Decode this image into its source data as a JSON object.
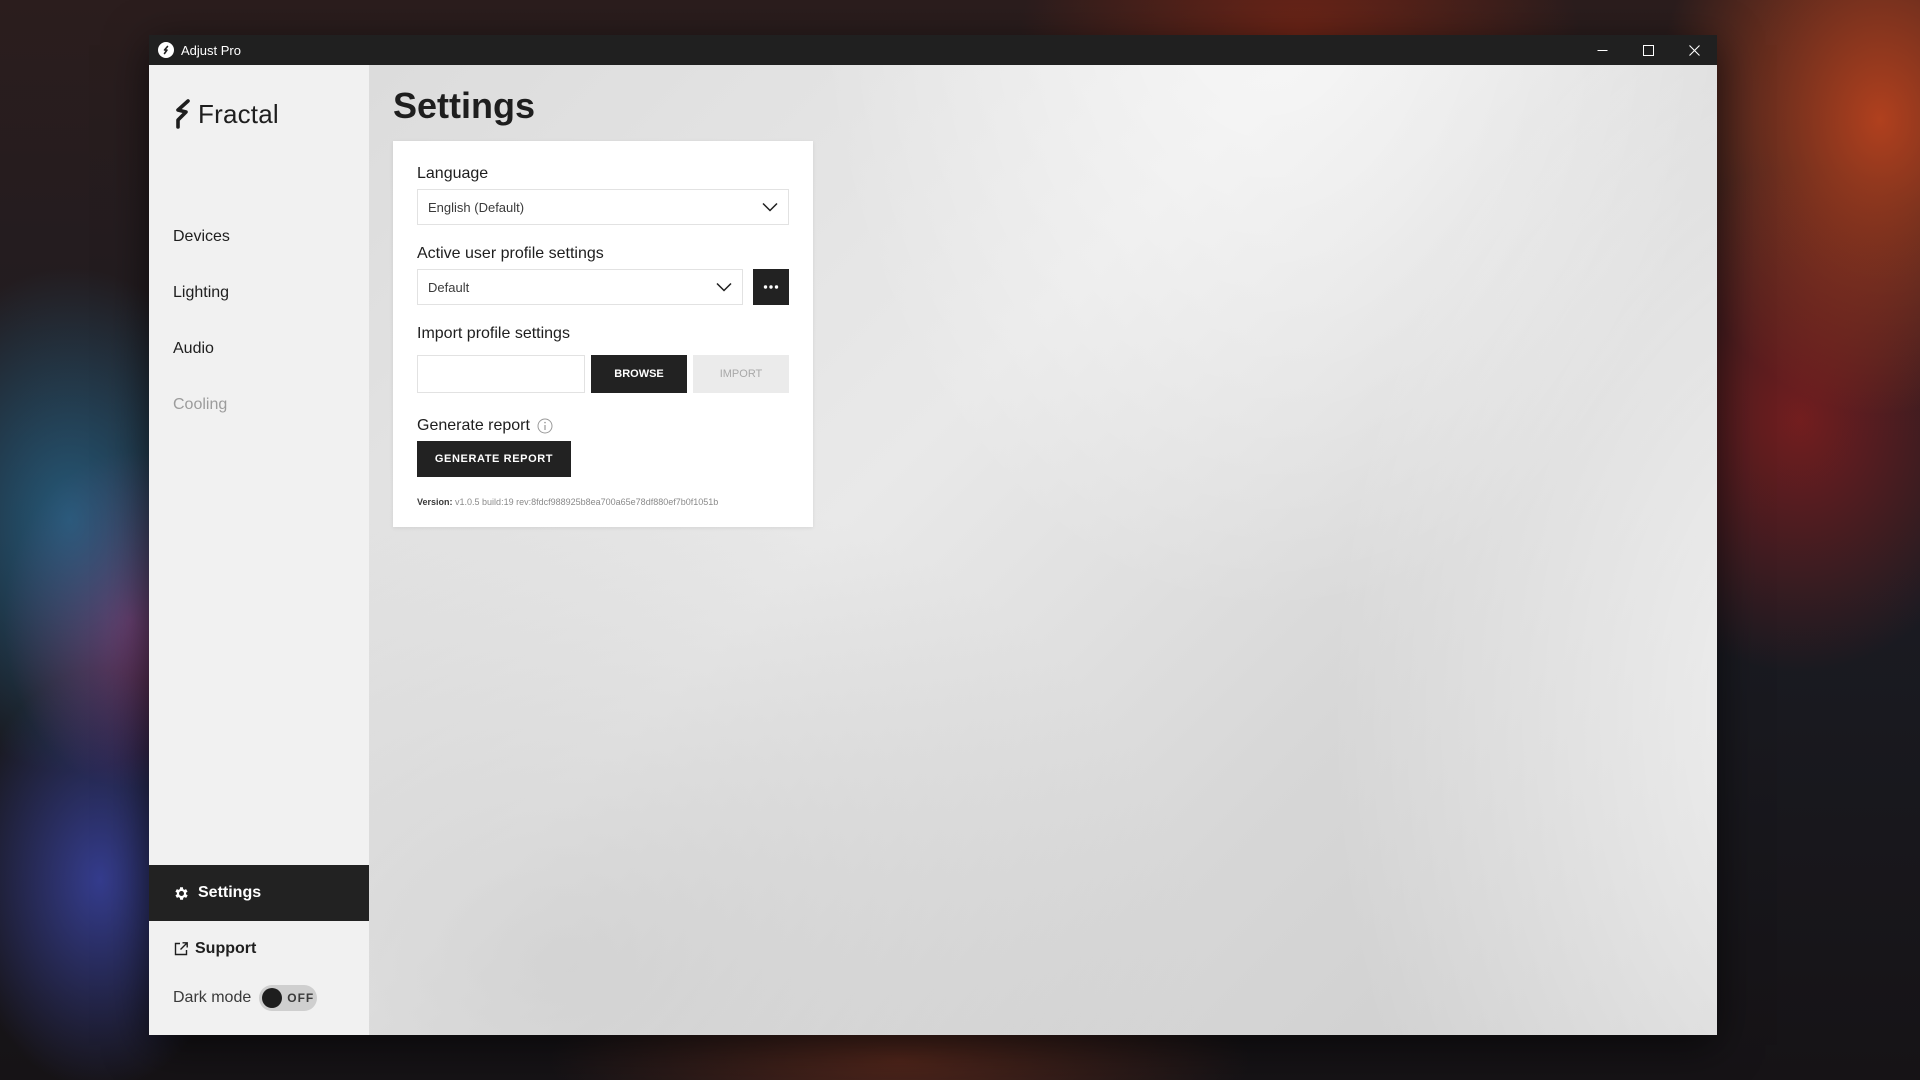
{
  "window": {
    "title": "Adjust Pro"
  },
  "sidebar": {
    "brand": "Fractal",
    "items": [
      {
        "label": "Devices",
        "enabled": true
      },
      {
        "label": "Lighting",
        "enabled": true
      },
      {
        "label": "Audio",
        "enabled": true
      },
      {
        "label": "Cooling",
        "enabled": false
      }
    ],
    "settings_label": "Settings",
    "support_label": "Support",
    "dark_mode_label": "Dark mode",
    "dark_mode_state": "OFF"
  },
  "main": {
    "title": "Settings",
    "language": {
      "label": "Language",
      "value": "English (Default)"
    },
    "profile": {
      "label": "Active user profile settings",
      "value": "Default"
    },
    "import": {
      "label": "Import profile settings",
      "file_value": "",
      "browse_label": "BROWSE",
      "import_label": "IMPORT"
    },
    "report": {
      "label": "Generate report",
      "button_label": "GENERATE REPORT"
    },
    "version": {
      "label": "Version:",
      "value": "v1.0.5 build:19 rev:8fdcf988925b8ea700a65e78df880ef7b0f1051b"
    }
  },
  "colors": {
    "titlebar": "#202020",
    "sidebar": "#f1f1f1",
    "dark_button": "#222222",
    "disabled_text": "#9c9c9c"
  },
  "icons": [
    "app-icon",
    "fractal-logo-icon",
    "minimize-icon",
    "maximize-icon",
    "close-icon",
    "chevron-down-icon",
    "more-icon",
    "info-icon",
    "gear-icon",
    "external-link-icon"
  ]
}
